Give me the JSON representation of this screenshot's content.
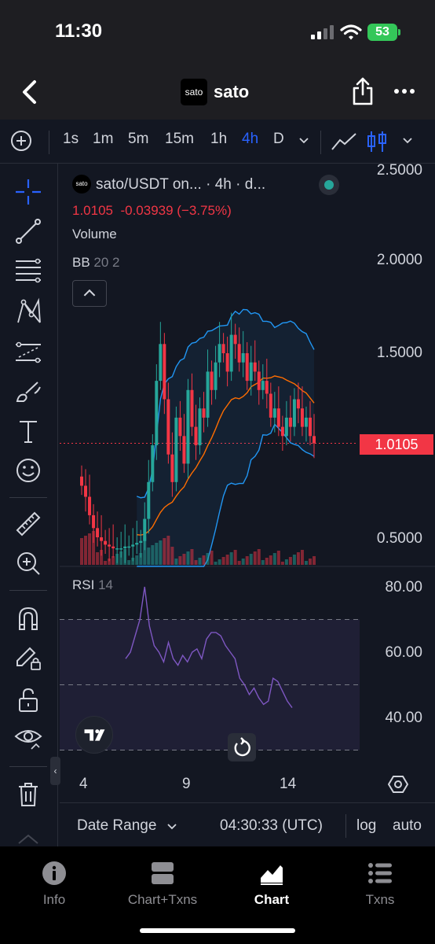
{
  "status_bar": {
    "time": "11:30",
    "battery": "53"
  },
  "header": {
    "logo_text": "sato",
    "title": "sato"
  },
  "timeframes": [
    {
      "label": "1s",
      "active": false
    },
    {
      "label": "1m",
      "active": false
    },
    {
      "label": "5m",
      "active": false
    },
    {
      "label": "15m",
      "active": false
    },
    {
      "label": "1h",
      "active": false
    },
    {
      "label": "4h",
      "active": true
    },
    {
      "label": "D",
      "active": false
    }
  ],
  "legend": {
    "logo_text": "sato",
    "symbol": "sato/USDT on...  · 4h · d...",
    "last_price": "1.0105",
    "change": "-0.03939 (−3.75%)",
    "volume_label": "Volume",
    "bb_label": "BB",
    "bb_params": "20 2"
  },
  "price_axis": [
    "2.5000",
    "2.0000",
    "1.5000",
    "0.5000"
  ],
  "current_price_tag": "1.0105",
  "rsi": {
    "label": "RSI",
    "param": "14",
    "axis": [
      "80.00",
      "60.00",
      "40.00"
    ]
  },
  "time_axis": [
    "4",
    "9",
    "14"
  ],
  "bottom": {
    "date_range": "Date Range",
    "clock": "04:30:33 (UTC)",
    "log": "log",
    "auto": "auto"
  },
  "tabs": [
    {
      "label": "Info",
      "active": false
    },
    {
      "label": "Chart+Txns",
      "active": false
    },
    {
      "label": "Chart",
      "active": true
    },
    {
      "label": "Txns",
      "active": false
    }
  ],
  "colors": {
    "up": "#26a69a",
    "down": "#f23645",
    "bb_band": "#2196f3",
    "bb_basis": "#ff6d00",
    "rsi_line": "#7e57c2",
    "accent": "#2962ff"
  },
  "chart_data": [
    {
      "type": "candlestick",
      "title": "sato/USDT",
      "interval": "4h",
      "ylim": [
        0.3,
        2.5
      ],
      "y_ticks": [
        0.5,
        1.5,
        2.0,
        2.5
      ],
      "x_ticks": [
        "4",
        "9",
        "14"
      ],
      "last": 1.0105,
      "close_series": [
        0.78,
        0.72,
        0.62,
        0.55,
        0.5,
        0.48,
        0.46,
        0.45,
        0.44,
        0.44,
        0.44,
        0.45,
        0.45,
        0.46,
        0.47,
        0.48,
        0.6,
        0.8,
        1.0,
        1.35,
        1.55,
        1.25,
        0.95,
        0.8,
        1.15,
        1.05,
        0.9,
        1.3,
        1.1,
        1.0,
        1.2,
        1.15,
        1.4,
        1.3,
        1.45,
        1.55,
        1.5,
        1.4,
        1.6,
        1.55,
        1.45,
        1.5,
        1.35,
        1.45,
        1.4,
        1.3,
        1.35,
        1.28,
        1.15,
        1.2,
        1.1,
        1.05,
        1.15,
        1.1,
        1.25,
        1.2,
        1.1,
        1.15,
        1.05,
        1.0105
      ],
      "overlays": [
        "Bollinger Bands (20, 2)",
        "Volume"
      ]
    },
    {
      "type": "line",
      "title": "RSI",
      "params": "14",
      "ylim": [
        30,
        82
      ],
      "y_ticks": [
        40,
        60,
        80
      ],
      "bands": [
        30,
        50,
        70
      ],
      "values": [
        58,
        60,
        65,
        70,
        80,
        68,
        62,
        60,
        57,
        63,
        58,
        56,
        59,
        57,
        60,
        61,
        58,
        64,
        66,
        66,
        65,
        62,
        60,
        58,
        52,
        50,
        47,
        49,
        46,
        44,
        45,
        52,
        51,
        48,
        45,
        43
      ]
    }
  ]
}
